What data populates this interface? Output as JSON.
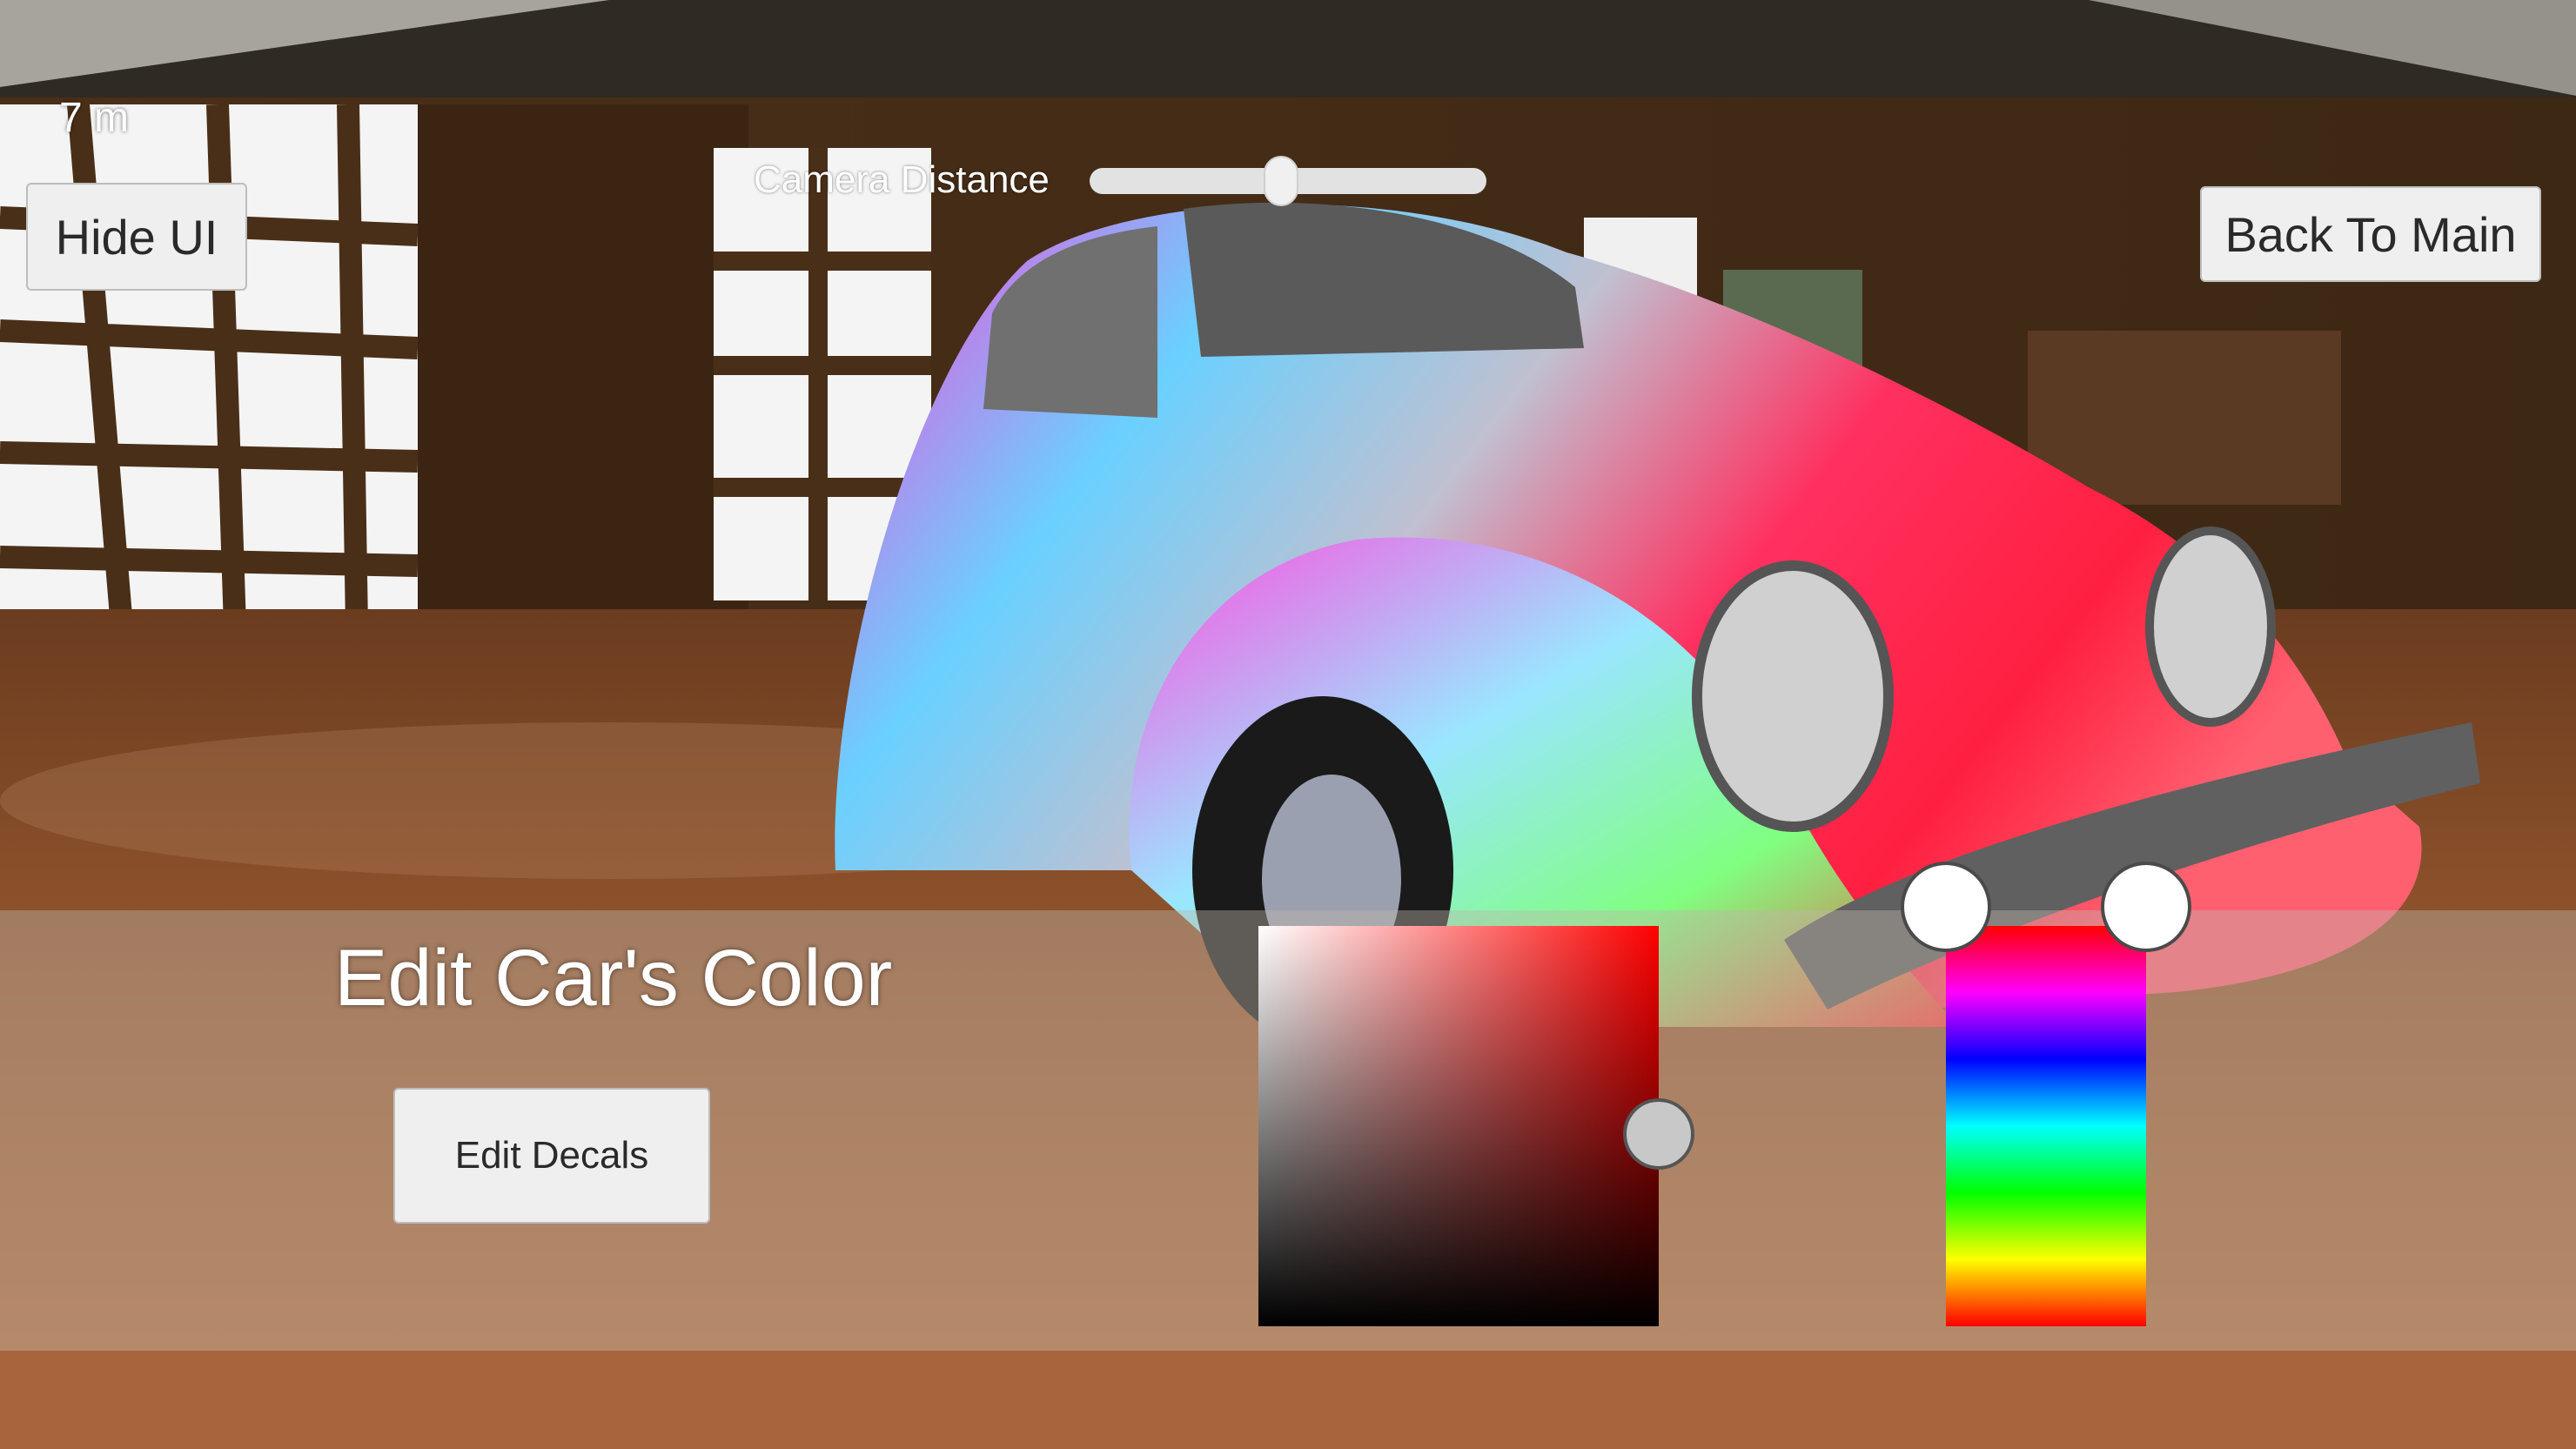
{
  "hud": {
    "fps_text": "7 m"
  },
  "toolbar": {
    "hide_ui_label": "Hide UI",
    "back_label": "Back To Main"
  },
  "camera": {
    "label": "Camera Distance",
    "value": 0.48
  },
  "panel": {
    "title": "Edit Car's Color",
    "edit_decals_label": "Edit Decals"
  },
  "color_picker": {
    "saturation": 1.0,
    "value": 0.48,
    "hue_min": 0.0,
    "hue_max": 1.0,
    "sv_base_color": "#ff0000"
  },
  "colors": {
    "panel_bg": "#beb4ac",
    "button_bg": "#efefef"
  }
}
